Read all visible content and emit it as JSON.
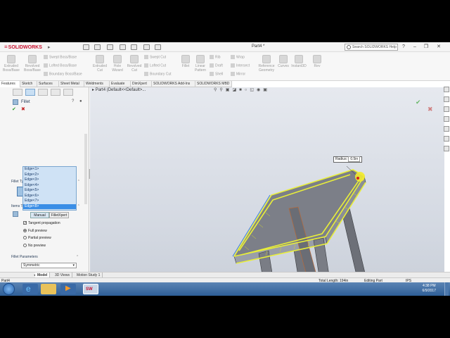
{
  "app": {
    "brand": "SOLIDWORKS",
    "document_title": "Part4 *"
  },
  "search": {
    "placeholder": "Search SOLIDWORKS Help"
  },
  "ribbon": {
    "extruded_boss": "Extruded Boss/Base",
    "revolved_boss": "Revolved Boss/Base",
    "swept_boss": "Swept Boss/Base",
    "lofted_boss": "Lofted Boss/Base",
    "boundary_boss": "Boundary Boss/Base",
    "extruded_cut": "Extruded Cut",
    "hole_wizard": "Hole Wizard",
    "revolved_cut": "Revolved Cut",
    "swept_cut": "Swept Cut",
    "lofted_cut": "Lofted Cut",
    "boundary_cut": "Boundary Cut",
    "fillet": "Fillet",
    "linear_pattern": "Linear Pattern",
    "rib": "Rib",
    "draft": "Draft",
    "shell": "Shell",
    "wrap": "Wrap",
    "intersect": "Intersect",
    "mirror": "Mirror",
    "reference_geometry": "Reference Geometry",
    "curves": "Curves",
    "instant3d": "Instant3D",
    "rev": "Rev"
  },
  "tabs": [
    "Features",
    "Sketch",
    "Surfaces",
    "Sheet Metal",
    "Weldments",
    "Evaluate",
    "DimXpert",
    "SOLIDWORKS Add-Ins",
    "SOLIDWORKS MBD"
  ],
  "tree": {
    "part_name": "Part4",
    "config": "(Default<<Default>..."
  },
  "property_manager": {
    "title": "Fillet",
    "mode_manual": "Manual",
    "mode_filletxpert": "FilletXpert",
    "fillet_type_header": "Fillet Type",
    "items_header": "Items To Fillet",
    "edges": [
      "Edge<1>",
      "Edge<2>",
      "Edge<3>",
      "Edge<4>",
      "Edge<5>",
      "Edge<6>",
      "Edge<7>",
      "Edge<8>"
    ],
    "selected_edge_index": 7,
    "tangent_propagation": "Tangent propagation",
    "tangent_checked": true,
    "full_preview": "Full preview",
    "partial_preview": "Partial preview",
    "no_preview": "No preview",
    "preview_selected": "Full preview",
    "params_header": "Fillet Parameters",
    "symmetric": "Symmetric"
  },
  "callout": {
    "label": "Radius:",
    "value": "0.5in"
  },
  "bottom_tabs": [
    "Model",
    "3D Views",
    "Motion Study 1"
  ],
  "status": {
    "part": "Part4",
    "total_length": "Total Length: 194in",
    "editing": "Editing Part",
    "units": "IPS"
  },
  "clock": {
    "time": "4:38 PM",
    "date": "6/9/2017"
  },
  "colors": {
    "accent_red": "#c8102e",
    "selection_yellow": "#e8ee3a",
    "panel_blue": "#3a8ee6"
  }
}
